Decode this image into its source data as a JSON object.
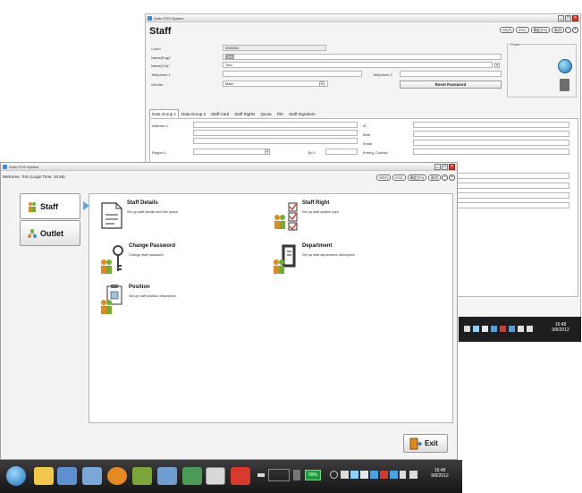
{
  "back_window": {
    "title": "Sotto POS System",
    "heading": "Staff",
    "pills": [
      "SP(F)",
      "ESC",
      "确定(F9)",
      "取消"
    ],
    "photo_label": "Photo",
    "fields": {
      "code_label": "Code*",
      "code_value": "0000001",
      "name_eng_label": "Name(Eng)*",
      "name_eng_value": "Tom",
      "name_chi_label": "Name(Chi)*",
      "name_chi_value": "Tom",
      "telephone1_label": "Telephone 1",
      "telephone2_label": "Telephone 2",
      "gender_label": "Gender",
      "gender_value": "Male",
      "reset_password_label": "Reset Password"
    },
    "tabs": [
      "Data Group 1",
      "Data Group 2",
      "Staff Card",
      "Staff Rights",
      "Quota",
      "File",
      "Staff Signature"
    ],
    "tab_fields": {
      "address1_label": "Address 1",
      "region1_label": "Region 1",
      "zip1_label": "Zip 1",
      "id_label": "ID",
      "birth_label": "Birth",
      "email_label": "Email",
      "emerg_contact_label": "Emerg. Contact"
    },
    "clock": {
      "time": "16:48",
      "date": "9/8/2012"
    }
  },
  "front_window": {
    "title": "Sotto POS System",
    "welcome": "Welcome, Tom (Login Time: 16:46)",
    "pills": [
      "SP(F)",
      "ESC",
      "确定(F9)",
      "取消"
    ],
    "nav": [
      {
        "label": "Staff",
        "active": true
      },
      {
        "label": "Outlet",
        "active": false
      }
    ],
    "items": [
      {
        "title": "Staff Details",
        "desc": "Set up staff details and free quota",
        "icon": "document-icon"
      },
      {
        "title": "Staff Right",
        "desc": "Set up staff system right",
        "icon": "checklist-icon"
      },
      {
        "title": "Change Password",
        "desc": "Change staff password",
        "icon": "key-icon"
      },
      {
        "title": "Department",
        "desc": "Set up staff department description",
        "icon": "door-icon"
      },
      {
        "title": "Position",
        "desc": "Set up staff position description",
        "icon": "position-icon"
      }
    ],
    "exit_label": "Exit"
  },
  "taskbar": {
    "battery": "99%",
    "time": "16:48",
    "date": "9/8/2012"
  },
  "colors": {
    "nav_caret": "#5aa7e6",
    "close_button": "#d9392c",
    "battery": "#1c9b3a",
    "taskbar": "#1e1e1e"
  }
}
